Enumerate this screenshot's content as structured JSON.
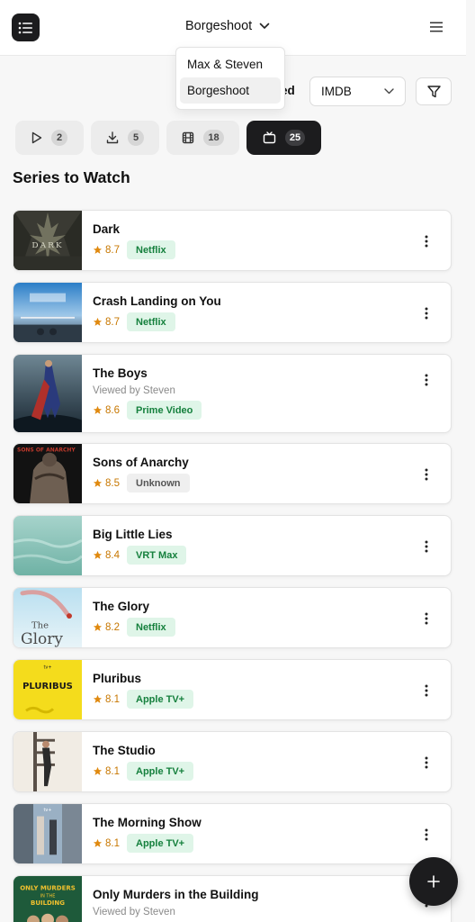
{
  "header": {
    "title": "Borgeshoot",
    "menu_icon": "list-menu-icon",
    "nav_icon": "hamburger-icon"
  },
  "dropdown": {
    "items": [
      {
        "label": "Max & Steven"
      },
      {
        "label": "Borgeshoot",
        "selected": true
      }
    ]
  },
  "toolbar": {
    "partial_label": "ed",
    "sort_select": {
      "value": "IMDB"
    },
    "filter_icon": "filter-icon"
  },
  "tabs": [
    {
      "icon": "play-icon",
      "count": "2"
    },
    {
      "icon": "download-icon",
      "count": "5"
    },
    {
      "icon": "film-icon",
      "count": "18"
    },
    {
      "icon": "tv-icon",
      "count": "25",
      "active": true
    }
  ],
  "section_title": "Series to Watch",
  "series": [
    {
      "title": "Dark",
      "rating": "8.7",
      "provider": "Netflix",
      "provider_style": "green"
    },
    {
      "title": "Crash Landing on You",
      "rating": "8.7",
      "provider": "Netflix",
      "provider_style": "green"
    },
    {
      "title": "The Boys",
      "viewed": "Viewed by Steven",
      "rating": "8.6",
      "provider": "Prime Video",
      "provider_style": "green"
    },
    {
      "title": "Sons of Anarchy",
      "rating": "8.5",
      "provider": "Unknown",
      "provider_style": "gray"
    },
    {
      "title": "Big Little Lies",
      "rating": "8.4",
      "provider": "VRT Max",
      "provider_style": "green"
    },
    {
      "title": "The Glory",
      "rating": "8.2",
      "provider": "Netflix",
      "provider_style": "green"
    },
    {
      "title": "Pluribus",
      "rating": "8.1",
      "provider": "Apple TV+",
      "provider_style": "green"
    },
    {
      "title": "The Studio",
      "rating": "8.1",
      "provider": "Apple TV+",
      "provider_style": "green"
    },
    {
      "title": "The Morning Show",
      "rating": "8.1",
      "provider": "Apple TV+",
      "provider_style": "green"
    },
    {
      "title": "Only Murders in the Building",
      "viewed": "Viewed by Steven"
    }
  ],
  "poster_text": {
    "dark": "DARK",
    "pluribus_brand": "tv+",
    "pluribus": "PLURIBUS",
    "glory_1": "The",
    "glory_2": "Glory",
    "soa": "SONS OF ANARCHY",
    "tms_brand": "tv+",
    "omitb_1": "ONLY MURDERS",
    "omitb_2": "IN THE",
    "omitb_3": "BUILDING"
  },
  "colors": {
    "accent_dark": "#1c1c1e",
    "rating": "#c77700",
    "badge_green_bg": "#dff5e8",
    "badge_green_text": "#15803d"
  }
}
